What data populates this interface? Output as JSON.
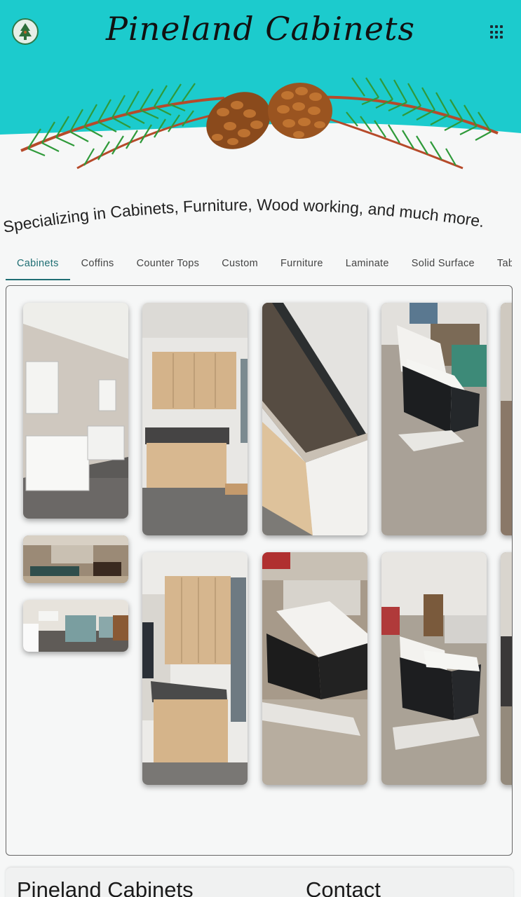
{
  "header": {
    "brand": "Pineland Cabinets",
    "logo_icon": "pine-tree-logo-icon",
    "menu_icon": "grid-menu-icon",
    "band_color": "#1ccbcd"
  },
  "tagline": "Specializing in Cabinets, Furniture, Wood working, and much more.",
  "tabs": [
    {
      "label": "Cabinets",
      "active": true
    },
    {
      "label": "Coffins"
    },
    {
      "label": "Counter Tops"
    },
    {
      "label": "Custom"
    },
    {
      "label": "Furniture"
    },
    {
      "label": "Laminate"
    },
    {
      "label": "Solid Surface"
    },
    {
      "label": "Tab"
    }
  ],
  "footer": {
    "name_heading": "Pineland Cabinets",
    "contact_heading": "Contact"
  },
  "colors": {
    "accent": "#1f6e73",
    "teal_band": "#1ccbcd"
  }
}
